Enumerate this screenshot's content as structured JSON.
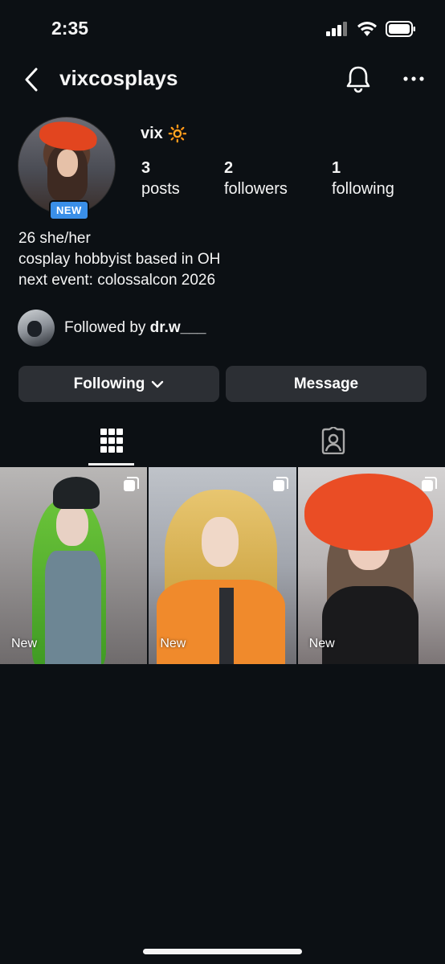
{
  "status_bar": {
    "time": "2:35"
  },
  "header": {
    "username": "vixcosplays"
  },
  "profile": {
    "badge": "NEW",
    "display_name": "vix",
    "name_emoji": "🔆",
    "stats": [
      {
        "count": "3",
        "label": "posts"
      },
      {
        "count": "2",
        "label": "followers"
      },
      {
        "count": "1",
        "label": "following"
      }
    ],
    "bio": [
      "26 she/her",
      "cosplay hobbyist based in OH",
      "next event: colossalcon 2026"
    ],
    "followed_by": {
      "prefix": "Followed by ",
      "user": "dr.w___"
    }
  },
  "actions": {
    "following_label": "Following",
    "message_label": "Message"
  },
  "posts": [
    {
      "label": "New"
    },
    {
      "label": "New"
    },
    {
      "label": "New"
    }
  ],
  "colors": {
    "background": "#0c1014",
    "button": "#2c2f34",
    "badge": "#3a8fe8"
  }
}
